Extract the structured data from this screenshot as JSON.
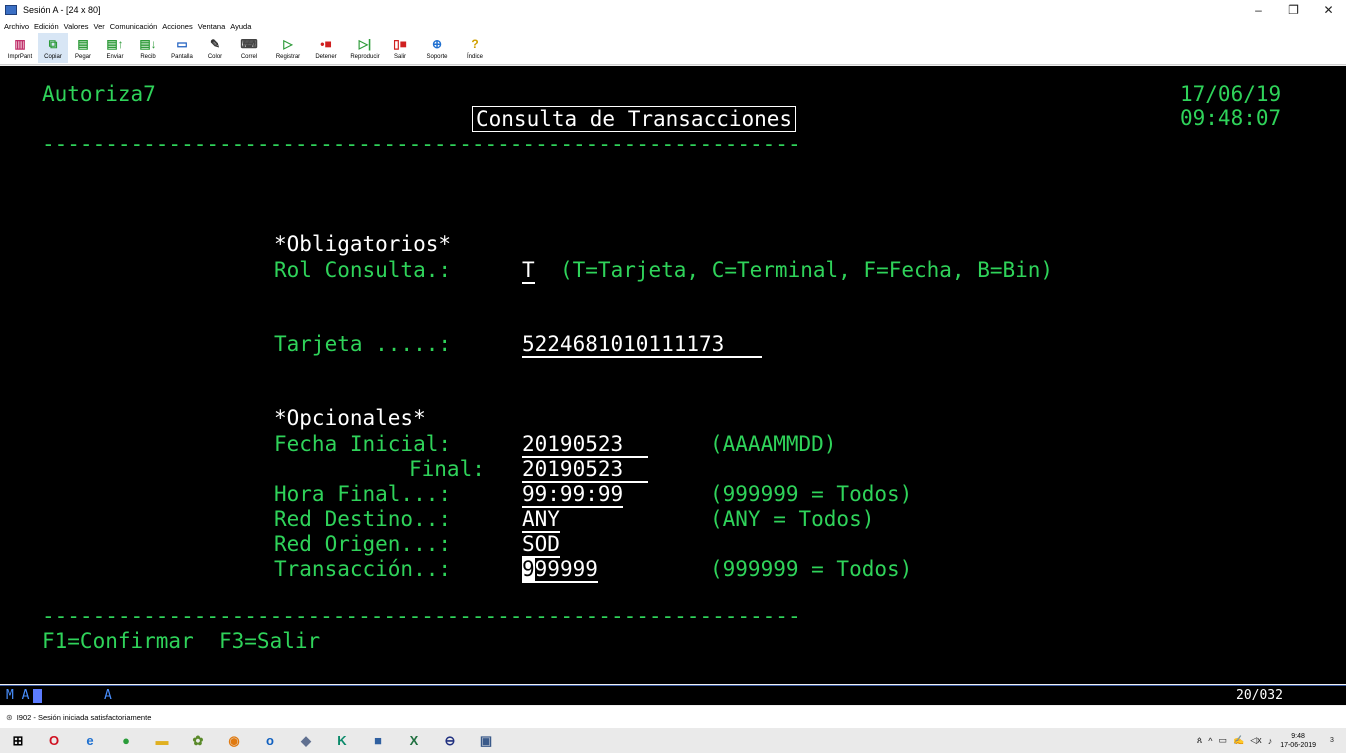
{
  "window": {
    "title": "Sesión A - [24 x 80]"
  },
  "menu": [
    "Archivo",
    "Edición",
    "Valores",
    "Ver",
    "Comunicación",
    "Acciones",
    "Ventana",
    "Ayuda"
  ],
  "toolbar": [
    {
      "label": "ImprPant",
      "icon": "print-screen-icon",
      "color": "#c0306a"
    },
    {
      "label": "Copiar",
      "icon": "copy-icon",
      "color": "#2e9b3a"
    },
    {
      "label": "Pegar",
      "icon": "paste-icon",
      "color": "#2e9b3a"
    },
    {
      "label": "Enviar",
      "icon": "send-icon",
      "color": "#2e9b3a"
    },
    {
      "label": "Recib",
      "icon": "receive-icon",
      "color": "#2e9b3a"
    },
    {
      "label": "Pantalla",
      "icon": "display-icon",
      "color": "#2060c0"
    },
    {
      "label": "Color",
      "icon": "color-icon",
      "color": "#333333"
    },
    {
      "label": "Correl",
      "icon": "keyboard-icon",
      "color": "#444444"
    },
    {
      "label": "Registrar",
      "icon": "record-icon",
      "color": "#2e9b3a"
    },
    {
      "label": "Detener",
      "icon": "stop-icon",
      "color": "#d02020"
    },
    {
      "label": "Reproducir",
      "icon": "play-icon",
      "color": "#2e9b3a"
    },
    {
      "label": "Salir",
      "icon": "exit-icon",
      "color": "#d02020"
    },
    {
      "label": "Soporte",
      "icon": "support-globe-icon",
      "color": "#2070d0"
    },
    {
      "label": "Índice",
      "icon": "help-index-icon",
      "color": "#d0a000"
    }
  ],
  "screen": {
    "program": "Autoriza7",
    "date": "17/06/19",
    "time": "09:48:07",
    "heading": "Consulta de Transacciones",
    "separator": "------------------------------------------------------------",
    "obligatorios_title": "*Obligatorios*",
    "rol_label": "Rol Consulta.:",
    "rol_value": "T",
    "rol_hint": "(T=Tarjeta, C=Terminal, F=Fecha, B=Bin)",
    "tarjeta_label": "Tarjeta .....:",
    "tarjeta_value": "5224681010111173   ",
    "opcionales_title": "*Opcionales*",
    "fecha_inicial_label": "Fecha Inicial:",
    "fecha_inicial_value": "20190523  ",
    "fecha_hint": "(AAAAMMDD)",
    "final_label": "Final:",
    "final_value": "20190523  ",
    "hora_label": "Hora Final...:",
    "hora_value": "99:99:99",
    "hora_hint": "(999999 = Todos)",
    "red_destino_label": "Red Destino..:",
    "red_destino_value": "ANY",
    "red_destino_hint": "(ANY = Todos)",
    "red_origen_label": "Red Origen...:",
    "red_origen_value": "SOD",
    "transaccion_label": "Transacción..:",
    "transaccion_cursor": "9",
    "transaccion_value": "99999",
    "transaccion_hint": "(999999 = Todos)",
    "fkeys": "F1=Confirmar  F3=Salir"
  },
  "oia": {
    "left": "M A",
    "mid": "A",
    "position": "20/032"
  },
  "status": {
    "text": "I902 - Sesión iniciada satisfactoriamente"
  },
  "taskbar": {
    "icons": [
      {
        "icon": "start-windows-icon",
        "glyph": "⊞",
        "color": "#000000"
      },
      {
        "icon": "opera-icon",
        "glyph": "O",
        "color": "#d01020"
      },
      {
        "icon": "internet-explorer-icon",
        "glyph": "e",
        "color": "#1e70d0"
      },
      {
        "icon": "chrome-icon",
        "glyph": "●",
        "color": "#2a9d3a"
      },
      {
        "icon": "file-explorer-icon",
        "glyph": "▬",
        "color": "#e0b020"
      },
      {
        "icon": "app-icon",
        "glyph": "✿",
        "color": "#5a8a2a"
      },
      {
        "icon": "firefox-icon",
        "glyph": "◉",
        "color": "#e07a10"
      },
      {
        "icon": "outlook-icon",
        "glyph": "o",
        "color": "#1060c0"
      },
      {
        "icon": "app2-icon",
        "glyph": "◆",
        "color": "#607090"
      },
      {
        "icon": "kaspersky-icon",
        "glyph": "K",
        "color": "#0a8a6a"
      },
      {
        "icon": "remote-icon",
        "glyph": "■",
        "color": "#3060a0"
      },
      {
        "icon": "excel-icon",
        "glyph": "X",
        "color": "#207040"
      },
      {
        "icon": "minus-app-icon",
        "glyph": "⊖",
        "color": "#203080"
      },
      {
        "icon": "terminal-app-icon",
        "glyph": "▣",
        "color": "#3a5a8a"
      }
    ],
    "time": "9:48",
    "date": "17-06-2019",
    "notifications": "3"
  }
}
